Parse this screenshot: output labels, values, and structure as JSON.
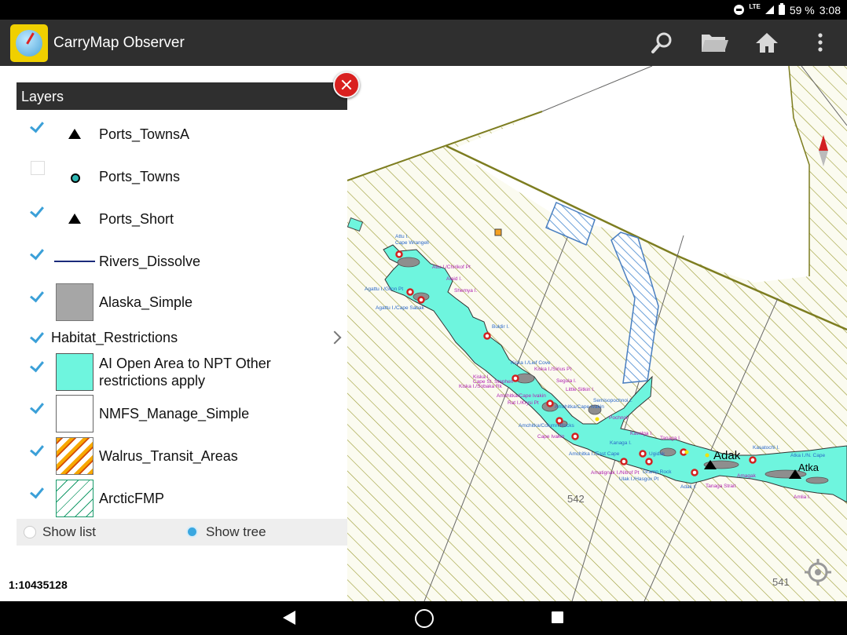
{
  "status_bar": {
    "network": "LTE",
    "battery_percent": "59 %",
    "time": "3:08"
  },
  "app_bar": {
    "title": "CarryMap Observer",
    "actions": [
      "search-icon",
      "folder-icon",
      "home-icon",
      "more-vert-icon"
    ]
  },
  "layers_panel": {
    "title": "Layers",
    "items": [
      {
        "label": "Ports_TownsA",
        "checked": true,
        "symbol": "black-triangle"
      },
      {
        "label": "Ports_Towns",
        "checked": false,
        "symbol": "teal-dot"
      },
      {
        "label": "Ports_Short",
        "checked": true,
        "symbol": "black-triangle"
      },
      {
        "label": "Rivers_Dissolve",
        "checked": true,
        "symbol": "navy-line"
      },
      {
        "label": "Alaska_Simple",
        "checked": true,
        "symbol": "gray-fill"
      },
      {
        "label": "Habitat_Restrictions",
        "checked": true,
        "symbol": "group"
      },
      {
        "label": "AI Open Area to NPT Other restrictions apply",
        "checked": true,
        "symbol": "aqua-fill"
      },
      {
        "label": "NMFS_Manage_Simple",
        "checked": true,
        "symbol": "white-fill"
      },
      {
        "label": "Walrus_Transit_Areas",
        "checked": true,
        "symbol": "orange-hatch"
      },
      {
        "label": "ArcticFMP",
        "checked": true,
        "symbol": "green-hatch"
      }
    ],
    "view_mode": {
      "options": [
        "Show list",
        "Show tree"
      ],
      "selected": "Show tree"
    }
  },
  "map": {
    "scale": "1:10435128",
    "region_labels": [
      "542",
      "541"
    ],
    "place_labels_large": [
      "Adak",
      "Atka"
    ],
    "place_labels": [
      "Attu I.",
      "Cape Wrangell",
      "Attu I./Chirikof Pt",
      "Alaid I.",
      "Shemya I.",
      "Agattu I./Gilon Pt",
      "Agattu I./Cape Sabak",
      "Buldir I.",
      "Kiska I./Lief Cove",
      "Kiska I./Sirius Pt",
      "Kiska I.",
      "Cape St. Stephen",
      "Kiska I./Sobaka Rk",
      "Segula I.",
      "Little Sitkin I.",
      "Rat I./Krysi Pt",
      "Amchitka/Cape Ivakin",
      "Amatignak I./Nitrof Pt",
      "Ulak I./Hasgox Pt",
      "Kanaga I.",
      "Tanaga I.",
      "Kasatochi I.",
      "Amchitka/Column Rocks",
      "Cape Ivakin",
      "Amchitka I./East Cape",
      "Semisopochnoi I.",
      "Pochnoi",
      "Gramp Rock",
      "Adak I.",
      "Tanaga Strait",
      "Amagak",
      "Atka I./N. Cape",
      "Amlia I."
    ],
    "colors": {
      "hatch_lines": "#9a9a30",
      "boundary": "#7d7d20",
      "open_area": "#6ef5de",
      "land": "#9a9a9a",
      "walrus_blue_hatch": "#6a9fd8",
      "ports_dot": "#d22020"
    }
  },
  "nav_bar": [
    "back-icon",
    "home-circle-icon",
    "recents-icon"
  ]
}
